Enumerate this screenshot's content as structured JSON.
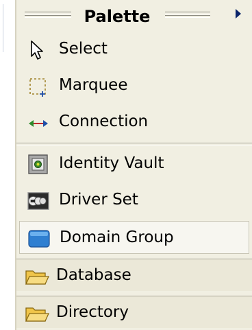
{
  "palette": {
    "title": "Palette"
  },
  "tools": [
    {
      "label": "Select",
      "icon": "arrow-pointer-icon"
    },
    {
      "label": "Marquee",
      "icon": "marquee-icon"
    },
    {
      "label": "Connection",
      "icon": "connection-icon"
    }
  ],
  "objects": [
    {
      "label": "Identity Vault",
      "icon": "identity-vault-icon"
    },
    {
      "label": "Driver Set",
      "icon": "driver-set-icon"
    },
    {
      "label": "Domain Group",
      "icon": "domain-group-icon"
    }
  ],
  "drawers": [
    {
      "label": "Database",
      "icon": "folder-icon"
    },
    {
      "label": "Directory",
      "icon": "folder-icon"
    }
  ],
  "colors": {
    "panel_bg": "#f1efe2",
    "drawer_bg": "#ebe8d8",
    "accent_blue": "#2f7fd1",
    "connection_green": "#2e8b2e",
    "connection_red": "#c0282d",
    "folder_yellow": "#f0c54a"
  }
}
